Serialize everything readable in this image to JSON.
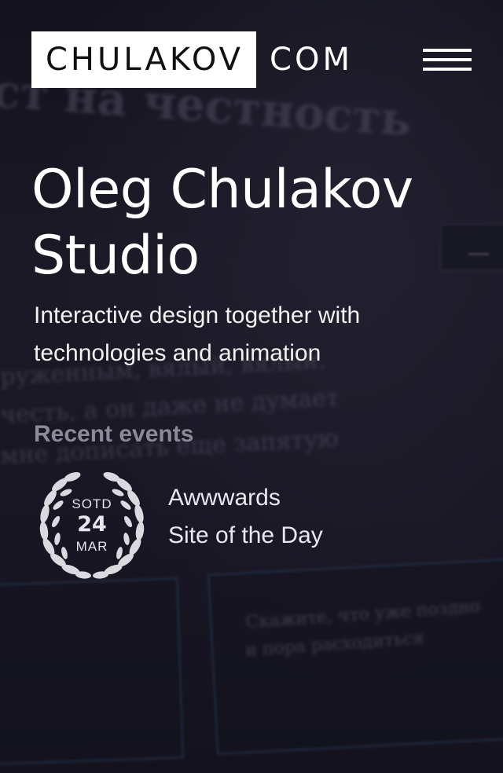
{
  "header": {
    "logo_main": "CHULAKOV",
    "logo_tld": "COM",
    "menu_icon": "hamburger-menu-icon"
  },
  "hero": {
    "title_line1": "Oleg Chulakov",
    "title_line2": "Studio",
    "subtitle_line1": "Interactive design together with",
    "subtitle_line2": "technologies and animation"
  },
  "events": {
    "heading": "Recent events",
    "items": [
      {
        "badge_top": "SOTD",
        "badge_day": "24",
        "badge_month": "MAR",
        "badge_icon": "laurel-wreath-icon",
        "title": "Awwwards",
        "subtitle": "Site of the Day"
      }
    ]
  },
  "background": {
    "line1": "ст на честность",
    "line2": "руженным, вялый, вялый.",
    "line3": "честь, а он даже не думает",
    "line4": "мне дописать еще запятую",
    "line5": "Скажите, что уже поздно",
    "line6": "и пора расходиться"
  },
  "colors": {
    "background": "#1a1826",
    "text": "#ffffff",
    "muted": "#8c8a98",
    "logo_box": "#ffffff",
    "logo_box_text": "#111111",
    "panel_border": "#4678aa"
  }
}
